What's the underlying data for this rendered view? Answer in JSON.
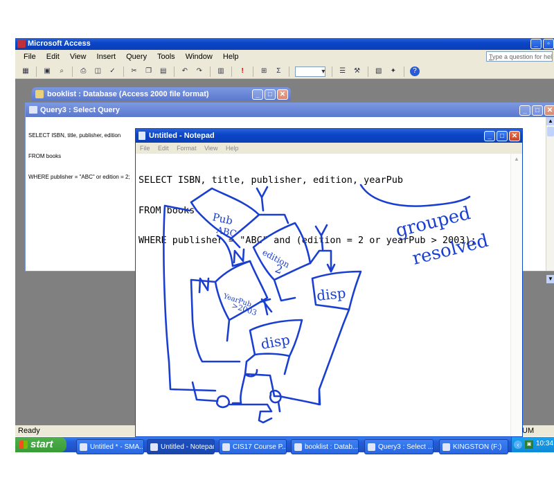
{
  "access": {
    "title": "Microsoft Access",
    "menu": [
      "File",
      "Edit",
      "View",
      "Insert",
      "Query",
      "Tools",
      "Window",
      "Help"
    ],
    "help_placeholder": "Type a question for help",
    "status": "Ready",
    "status_right": "UM"
  },
  "db_window": {
    "title": "booklist : Database (Access 2000 file format)"
  },
  "query_window": {
    "title": "Query3 : Select Query",
    "lines": [
      "SELECT ISBN, title, publisher, edition",
      "FROM books",
      "WHERE publisher = \"ABC\" or edition = 2;"
    ]
  },
  "notepad": {
    "title": "Untitled - Notepad",
    "menu": [
      "File",
      "Edit",
      "Format",
      "View",
      "Help"
    ],
    "lines": [
      "SELECT ISBN, title, publisher, edition, yearPub",
      "FROM books",
      "WHERE publisher = \"ABC\" and (edition = 2 or yearPub > 2003);"
    ]
  },
  "taskbar": {
    "start": "start",
    "buttons": [
      "Untitled * - SMA...",
      "Untitled - Notepad",
      "CIS17 Course P...",
      "booklist : Datab...",
      "Query3 : Select ...",
      "KINGSTON (F:)"
    ],
    "clock": "10:34"
  },
  "colors": {
    "ink": "#1a3fd0",
    "xp_blue": "#0a46c8",
    "taskbar": "#245edb"
  }
}
